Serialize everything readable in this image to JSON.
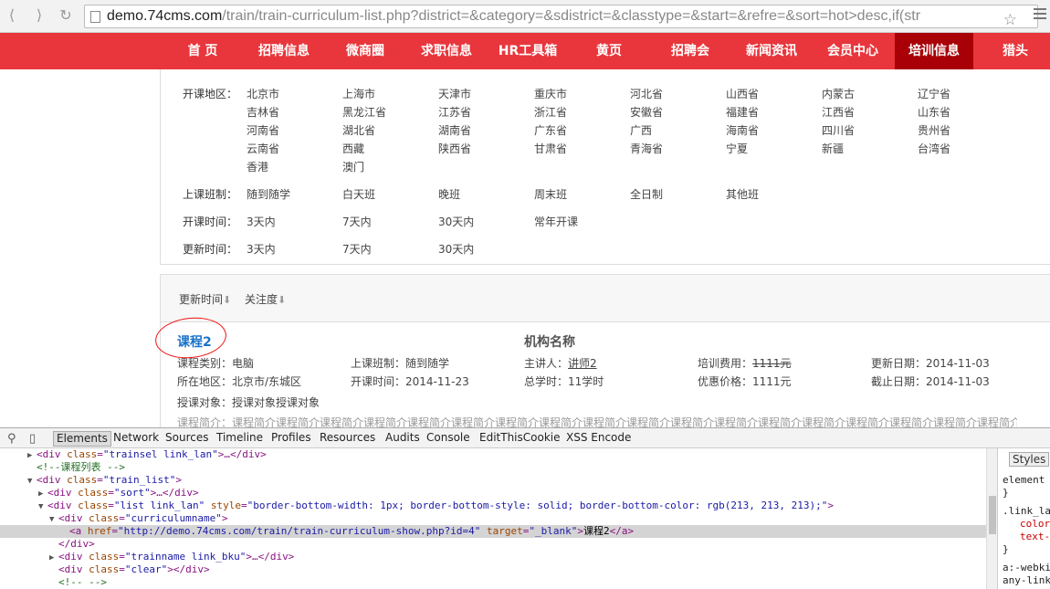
{
  "browser": {
    "url_host": "demo.74cms.com",
    "url_path": "/train/train-curriculum-list.php?district=&category=&sdistrict=&classtype=&start=&refre=&sort=hot>desc,if(str"
  },
  "nav": [
    "首 页",
    "招聘信息",
    "微商圈",
    "求职信息",
    "HR工具箱",
    "黄页",
    "招聘会",
    "新闻资讯",
    "会员中心",
    "培训信息",
    "猎头"
  ],
  "nav_active_index": 9,
  "filters": {
    "region_label": "开课地区：",
    "regions": [
      "北京市",
      "上海市",
      "天津市",
      "重庆市",
      "河北省",
      "山西省",
      "内蒙古",
      "辽宁省",
      "吉林省",
      "黑龙江省",
      "江苏省",
      "浙江省",
      "安徽省",
      "福建省",
      "江西省",
      "山东省",
      "河南省",
      "湖北省",
      "湖南省",
      "广东省",
      "广西",
      "海南省",
      "四川省",
      "贵州省",
      "云南省",
      "西藏",
      "陕西省",
      "甘肃省",
      "青海省",
      "宁夏",
      "新疆",
      "台湾省",
      "香港",
      "澳门"
    ],
    "classtype_label": "上课班制：",
    "classtypes": [
      "随到随学",
      "白天班",
      "晚班",
      "周末班",
      "全日制",
      "其他班"
    ],
    "start_label": "开课时间：",
    "starts": [
      "3天内",
      "7天内",
      "30天内",
      "常年开课"
    ],
    "refresh_label": "更新时间：",
    "refreshes": [
      "3天内",
      "7天内",
      "30天内"
    ]
  },
  "sort": {
    "items": [
      "更新时间",
      "关注度"
    ],
    "arrow": "⬇"
  },
  "course": {
    "name": "课程2",
    "institution": "机构名称",
    "category": "课程类别：电脑",
    "district": "所在地区：北京市/东城区",
    "target": "授课对象：授课对象授课对象",
    "classtype": "上课班制：随到随学",
    "start_time": "开课时间：2014-11-23",
    "lecturer_label": "主讲人：",
    "lecturer": "讲师2",
    "total_hours": "总学时：11学时",
    "fee_label": "培训费用：",
    "fee": "1111元",
    "discount": "优惠价格：1111元",
    "update_date": "更新日期：2014-11-03",
    "deadline": "截止日期：2014-11-03",
    "intro": "课程简介：课程简介课程简介课程简介课程简介课程简介课程简介课程简介课程简介课程简介课程简介课程简介课程简介课程简介课程简介课程简介课程简介课程简介课程简介课程..."
  },
  "devtools": {
    "tabs": [
      "Elements",
      "Network",
      "Sources",
      "Timeline",
      "Profiles",
      "Resources",
      "Audits",
      "Console",
      "EditThisCookie",
      "XSS Encode"
    ],
    "active_tab": "Elements",
    "styles_tab": "Styles",
    "styles_lines": [
      {
        "text": "element",
        "red": false
      },
      {
        "text": "}",
        "red": false
      },
      {
        "text": ".link_la",
        "red": false
      },
      {
        "text": "color",
        "red": true
      },
      {
        "text": "text-",
        "red": true
      },
      {
        "text": "}",
        "red": false
      },
      {
        "text": "a:-webki",
        "red": false
      },
      {
        "text": "any-link",
        "red": false
      }
    ],
    "code": {
      "l1_open": "<div ",
      "l1_attr": "class",
      "l1_val": "\"trainsel link_lan\"",
      "l1_close": ">…</div>",
      "l2_comment": "<!--课程列表 -->",
      "l3_open": "<div ",
      "l3_attr": "class",
      "l3_val": "\"train_list\"",
      "l3_close": ">",
      "l4_open": "<div ",
      "l4_attr": "class",
      "l4_val": "\"sort\"",
      "l4_close": ">…</div>",
      "l5_open": "<div ",
      "l5_attr1": "class",
      "l5_val1": "\"list link_lan\"",
      "l5_attr2": "style",
      "l5_val2": "\"border-bottom-width: 1px; border-bottom-style: solid; border-bottom-color: rgb(213, 213, 213);\"",
      "l5_close": ">",
      "l6_open": "<div ",
      "l6_attr": "class",
      "l6_val": "\"curriculumname\"",
      "l6_close": ">",
      "l7_open": "<a ",
      "l7_attr1": "href",
      "l7_val1": "\"http://demo.74cms.com/train/train-curriculum-show.php?id=4\"",
      "l7_attr2": "target",
      "l7_val2": "\"_blank\"",
      "l7_gt": ">",
      "l7_text": "课程2",
      "l7_end": "</a>",
      "l8_close": "</div>",
      "l9_open": "<div ",
      "l9_attr": "class",
      "l9_val": "\"trainname link_bku\"",
      "l9_close": ">…</div>",
      "l10_open": "<div ",
      "l10_attr": "class",
      "l10_val": "\"clear\"",
      "l10_close": "></div>",
      "l11_comment": "<!-- -->"
    }
  }
}
